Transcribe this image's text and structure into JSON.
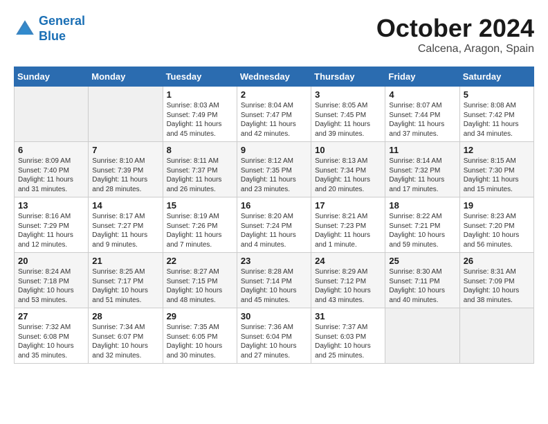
{
  "header": {
    "logo_line1": "General",
    "logo_line2": "Blue",
    "month": "October 2024",
    "location": "Calcena, Aragon, Spain"
  },
  "weekdays": [
    "Sunday",
    "Monday",
    "Tuesday",
    "Wednesday",
    "Thursday",
    "Friday",
    "Saturday"
  ],
  "weeks": [
    [
      {
        "day": "",
        "content": ""
      },
      {
        "day": "",
        "content": ""
      },
      {
        "day": "1",
        "content": "Sunrise: 8:03 AM\nSunset: 7:49 PM\nDaylight: 11 hours and 45 minutes."
      },
      {
        "day": "2",
        "content": "Sunrise: 8:04 AM\nSunset: 7:47 PM\nDaylight: 11 hours and 42 minutes."
      },
      {
        "day": "3",
        "content": "Sunrise: 8:05 AM\nSunset: 7:45 PM\nDaylight: 11 hours and 39 minutes."
      },
      {
        "day": "4",
        "content": "Sunrise: 8:07 AM\nSunset: 7:44 PM\nDaylight: 11 hours and 37 minutes."
      },
      {
        "day": "5",
        "content": "Sunrise: 8:08 AM\nSunset: 7:42 PM\nDaylight: 11 hours and 34 minutes."
      }
    ],
    [
      {
        "day": "6",
        "content": "Sunrise: 8:09 AM\nSunset: 7:40 PM\nDaylight: 11 hours and 31 minutes."
      },
      {
        "day": "7",
        "content": "Sunrise: 8:10 AM\nSunset: 7:39 PM\nDaylight: 11 hours and 28 minutes."
      },
      {
        "day": "8",
        "content": "Sunrise: 8:11 AM\nSunset: 7:37 PM\nDaylight: 11 hours and 26 minutes."
      },
      {
        "day": "9",
        "content": "Sunrise: 8:12 AM\nSunset: 7:35 PM\nDaylight: 11 hours and 23 minutes."
      },
      {
        "day": "10",
        "content": "Sunrise: 8:13 AM\nSunset: 7:34 PM\nDaylight: 11 hours and 20 minutes."
      },
      {
        "day": "11",
        "content": "Sunrise: 8:14 AM\nSunset: 7:32 PM\nDaylight: 11 hours and 17 minutes."
      },
      {
        "day": "12",
        "content": "Sunrise: 8:15 AM\nSunset: 7:30 PM\nDaylight: 11 hours and 15 minutes."
      }
    ],
    [
      {
        "day": "13",
        "content": "Sunrise: 8:16 AM\nSunset: 7:29 PM\nDaylight: 11 hours and 12 minutes."
      },
      {
        "day": "14",
        "content": "Sunrise: 8:17 AM\nSunset: 7:27 PM\nDaylight: 11 hours and 9 minutes."
      },
      {
        "day": "15",
        "content": "Sunrise: 8:19 AM\nSunset: 7:26 PM\nDaylight: 11 hours and 7 minutes."
      },
      {
        "day": "16",
        "content": "Sunrise: 8:20 AM\nSunset: 7:24 PM\nDaylight: 11 hours and 4 minutes."
      },
      {
        "day": "17",
        "content": "Sunrise: 8:21 AM\nSunset: 7:23 PM\nDaylight: 11 hours and 1 minute."
      },
      {
        "day": "18",
        "content": "Sunrise: 8:22 AM\nSunset: 7:21 PM\nDaylight: 10 hours and 59 minutes."
      },
      {
        "day": "19",
        "content": "Sunrise: 8:23 AM\nSunset: 7:20 PM\nDaylight: 10 hours and 56 minutes."
      }
    ],
    [
      {
        "day": "20",
        "content": "Sunrise: 8:24 AM\nSunset: 7:18 PM\nDaylight: 10 hours and 53 minutes."
      },
      {
        "day": "21",
        "content": "Sunrise: 8:25 AM\nSunset: 7:17 PM\nDaylight: 10 hours and 51 minutes."
      },
      {
        "day": "22",
        "content": "Sunrise: 8:27 AM\nSunset: 7:15 PM\nDaylight: 10 hours and 48 minutes."
      },
      {
        "day": "23",
        "content": "Sunrise: 8:28 AM\nSunset: 7:14 PM\nDaylight: 10 hours and 45 minutes."
      },
      {
        "day": "24",
        "content": "Sunrise: 8:29 AM\nSunset: 7:12 PM\nDaylight: 10 hours and 43 minutes."
      },
      {
        "day": "25",
        "content": "Sunrise: 8:30 AM\nSunset: 7:11 PM\nDaylight: 10 hours and 40 minutes."
      },
      {
        "day": "26",
        "content": "Sunrise: 8:31 AM\nSunset: 7:09 PM\nDaylight: 10 hours and 38 minutes."
      }
    ],
    [
      {
        "day": "27",
        "content": "Sunrise: 7:32 AM\nSunset: 6:08 PM\nDaylight: 10 hours and 35 minutes."
      },
      {
        "day": "28",
        "content": "Sunrise: 7:34 AM\nSunset: 6:07 PM\nDaylight: 10 hours and 32 minutes."
      },
      {
        "day": "29",
        "content": "Sunrise: 7:35 AM\nSunset: 6:05 PM\nDaylight: 10 hours and 30 minutes."
      },
      {
        "day": "30",
        "content": "Sunrise: 7:36 AM\nSunset: 6:04 PM\nDaylight: 10 hours and 27 minutes."
      },
      {
        "day": "31",
        "content": "Sunrise: 7:37 AM\nSunset: 6:03 PM\nDaylight: 10 hours and 25 minutes."
      },
      {
        "day": "",
        "content": ""
      },
      {
        "day": "",
        "content": ""
      }
    ]
  ]
}
